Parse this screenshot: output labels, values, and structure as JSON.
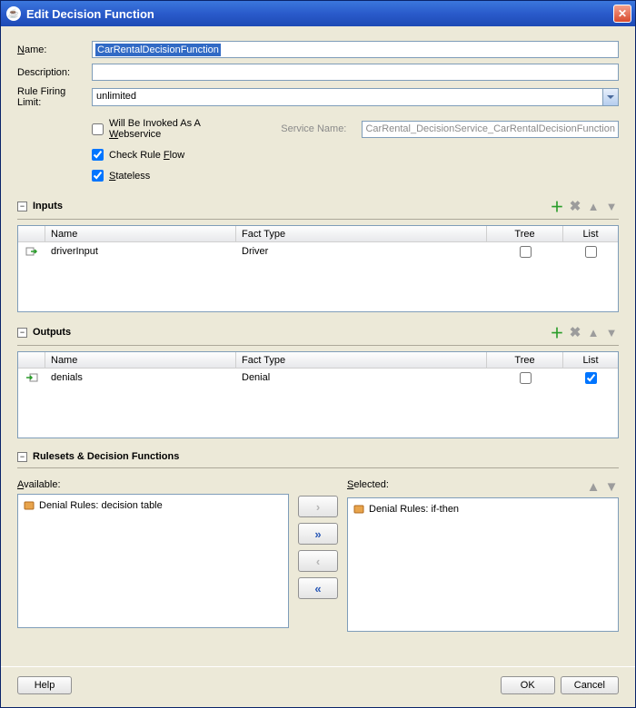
{
  "window": {
    "title": "Edit Decision Function"
  },
  "form": {
    "name_label": "Name:",
    "name_value": "CarRentalDecisionFunction",
    "desc_label": "Description:",
    "desc_value": "",
    "rfl_label": "Rule Firing Limit:",
    "rfl_value": "unlimited",
    "webservice_label_pre": "Will Be Invoked As A ",
    "webservice_label_u": "W",
    "webservice_label_post": "ebservice",
    "webservice_checked": false,
    "service_name_label": "Service Name:",
    "service_name_value": "CarRental_DecisionService_CarRentalDecisionFunction",
    "checkflow_label_pre": "Check Rule ",
    "checkflow_label_u": "F",
    "checkflow_label_post": "low",
    "checkflow_checked": true,
    "stateless_label_u": "S",
    "stateless_label_post": "tateless",
    "stateless_checked": true
  },
  "inputs": {
    "title": "Inputs",
    "columns": {
      "name": "Name",
      "fact": "Fact Type",
      "tree": "Tree",
      "list": "List"
    },
    "rows": [
      {
        "name": "driverInput",
        "fact": "Driver",
        "tree": false,
        "list": false
      }
    ]
  },
  "outputs": {
    "title": "Outputs",
    "columns": {
      "name": "Name",
      "fact": "Fact Type",
      "tree": "Tree",
      "list": "List"
    },
    "rows": [
      {
        "name": "denials",
        "fact": "Denial",
        "tree": false,
        "list": true
      }
    ]
  },
  "rulesets": {
    "title": "Rulesets & Decision Functions",
    "available_label": "Available:",
    "selected_label": "Selected:",
    "available": [
      {
        "label": "Denial Rules: decision table"
      }
    ],
    "selected": [
      {
        "label": "Denial Rules: if-then"
      }
    ]
  },
  "footer": {
    "help": "Help",
    "ok": "OK",
    "cancel": "Cancel"
  }
}
